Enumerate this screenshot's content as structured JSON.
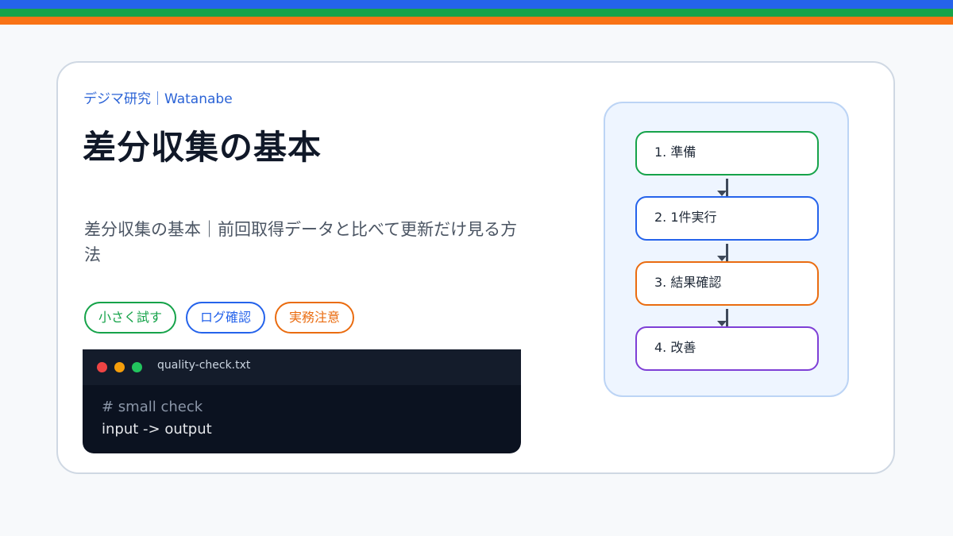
{
  "header": {
    "kicker": "デジマ研究｜Watanabe",
    "title": "差分収集の基本",
    "subtitle": "差分収集の基本｜前回取得データと比べて更新だけ見る方法"
  },
  "tags": [
    {
      "label": "小さく試す",
      "color": "#16a34a"
    },
    {
      "label": "ログ確認",
      "color": "#2563eb"
    },
    {
      "label": "実務注意",
      "color": "#ea6c10"
    }
  ],
  "terminal": {
    "filename": "quality-check.txt",
    "lines": [
      "# small check",
      "input -> output"
    ]
  },
  "flow": {
    "steps": [
      {
        "label": "1. 準備",
        "color": "#16a34a"
      },
      {
        "label": "2. 1件実行",
        "color": "#2563eb"
      },
      {
        "label": "3. 結果確認",
        "color": "#ea6c10"
      },
      {
        "label": "4. 改善",
        "color": "#7e3fd6"
      }
    ]
  },
  "colors": {
    "top_bar": [
      "#2563eb",
      "#16a34a",
      "#f97316"
    ],
    "background": "#f7f9fb",
    "card": "#ffffff"
  }
}
